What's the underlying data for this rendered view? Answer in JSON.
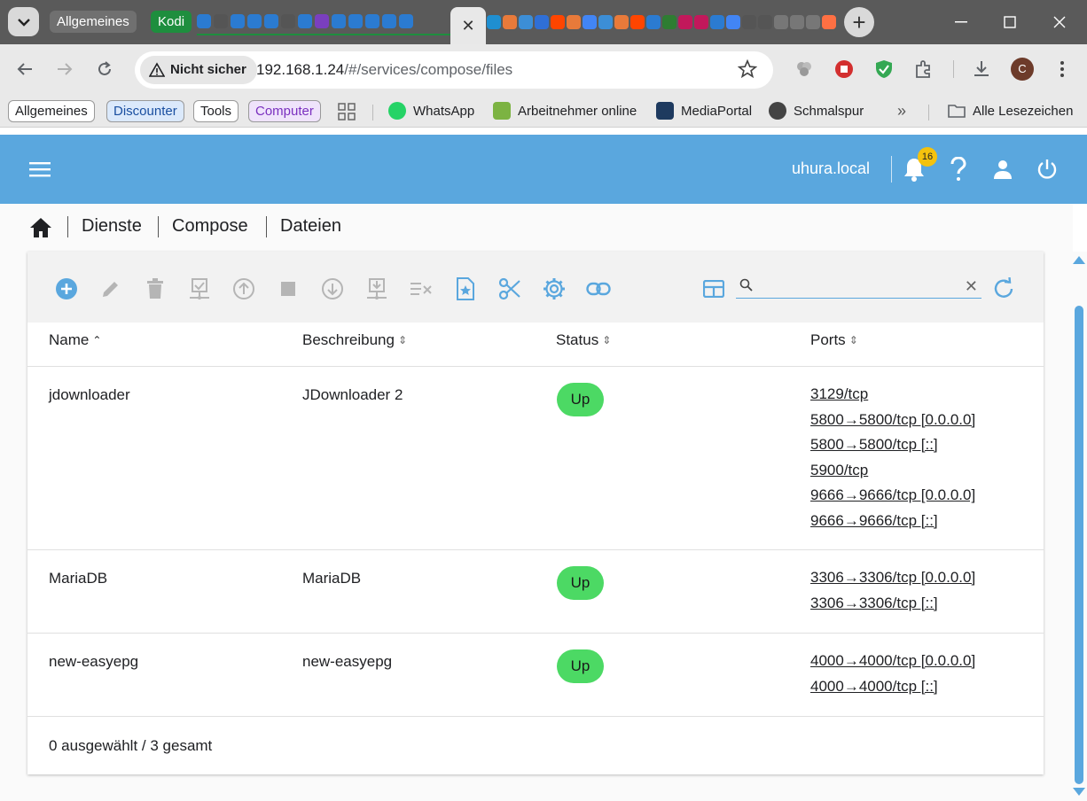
{
  "browser": {
    "tab_groups": [
      {
        "label": "Allgemeines",
        "color": "#707070"
      },
      {
        "label": "Kodi",
        "color": "#1e8e3e"
      }
    ],
    "active_tab_close": "✕",
    "new_tab": "+",
    "favicons_group1": [
      "#2b7bd1",
      "#555555",
      "#2b7bd1",
      "#2b7bd1",
      "#2b7bd1",
      "#555555",
      "#2b7bd1",
      "#7a3fbf",
      "#2b7bd1",
      "#2b7bd1",
      "#2b7bd1",
      "#2b7bd1",
      "#2b7bd1"
    ],
    "favicons_group2": [
      "#1f8fd1",
      "#e87a3a",
      "#3c8ed6",
      "#2f6fd6",
      "#ff4500",
      "#e87a3a",
      "#4285f4",
      "#3c8ed6",
      "#e87a3a",
      "#ff4500",
      "#2b7bd1",
      "#2e7d32",
      "#c2185b",
      "#c2185b",
      "#2b7bd1",
      "#4285f4",
      "#555555",
      "#555555",
      "#777777",
      "#777777",
      "#777777",
      "#ff7043"
    ],
    "address": {
      "security_label": "Nicht sicher",
      "url_host": "192.168.1.24",
      "url_path": "/#/services/compose/files"
    },
    "profile_initial": "C",
    "bookmarks": {
      "chips": [
        {
          "label": "Allgemeines",
          "bg": "#ffffff",
          "color": "#202124"
        },
        {
          "label": "Discounter",
          "bg": "#dbe9fb",
          "color": "#1a4fa0"
        },
        {
          "label": "Tools",
          "bg": "#ffffff",
          "color": "#202124"
        },
        {
          "label": "Computer",
          "bg": "#efe3fb",
          "color": "#7a2fbf"
        }
      ],
      "links": [
        {
          "label": "WhatsApp",
          "icon": "whatsapp-icon",
          "color": "#25d366"
        },
        {
          "label": "Arbeitnehmer online",
          "icon": "datev-icon",
          "color": "#7cb342"
        },
        {
          "label": "MediaPortal",
          "icon": "mediaportal-icon",
          "color": "#1e3a5f"
        },
        {
          "label": "Schmalspur",
          "icon": "globe-icon",
          "color": "#444444"
        }
      ],
      "overflow": "»",
      "all_bookmarks": "Alle Lesezeichen"
    }
  },
  "app": {
    "accent": "#5aa7de",
    "hostname": "uhura.local",
    "notifications_count": "16",
    "breadcrumb": [
      "Dienste",
      "Compose",
      "Dateien"
    ],
    "search": {
      "placeholder": "",
      "value": ""
    },
    "table": {
      "columns": [
        "Name",
        "Beschreibung",
        "Status",
        "Ports"
      ],
      "sort_indicators": [
        "⌃",
        "⇕",
        "⇕",
        "⇕"
      ],
      "rows": [
        {
          "name": "jdownloader",
          "description": "JDownloader 2",
          "status": "Up",
          "ports": [
            "3129/tcp",
            "5800→5800/tcp [0.0.0.0]",
            "5800→5800/tcp [::]",
            "5900/tcp",
            "9666→9666/tcp [0.0.0.0]",
            "9666→9666/tcp [::]"
          ]
        },
        {
          "name": "MariaDB",
          "description": "MariaDB",
          "status": "Up",
          "ports": [
            "3306→3306/tcp [0.0.0.0]",
            "3306→3306/tcp [::]"
          ]
        },
        {
          "name": "new-easyepg",
          "description": "new-easyepg",
          "status": "Up",
          "ports": [
            "4000→4000/tcp [0.0.0.0]",
            "4000→4000/tcp [::]"
          ]
        }
      ]
    },
    "footer": "0 ausgewählt / 3 gesamt",
    "status_color": "#4cd964"
  }
}
